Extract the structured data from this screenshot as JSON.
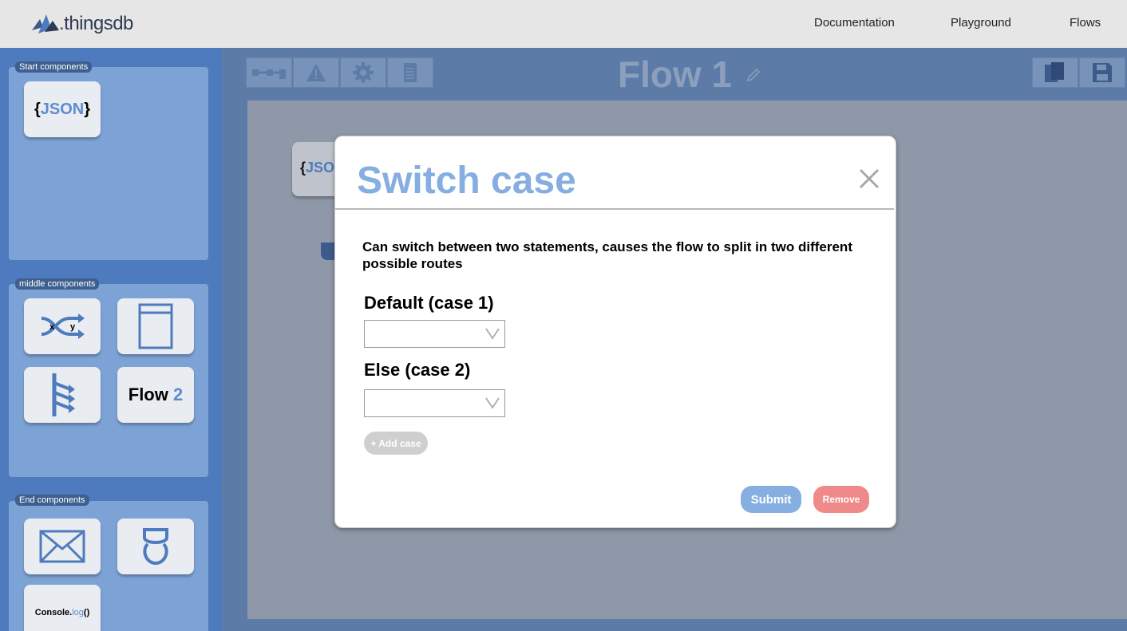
{
  "header": {
    "logo_text": ".thingsdb",
    "nav": [
      "Documentation",
      "Playground",
      "Flows"
    ]
  },
  "sidebar": {
    "start_label": "Start components",
    "middle_label": "middle components",
    "end_label": "End components",
    "start_tiles": [
      {
        "icon": "json-icon",
        "text_prefix": "{",
        "text_main": "JSON",
        "text_suffix": "}"
      }
    ],
    "middle_tiles": [
      {
        "icon": "switch-xy-icon",
        "x_label": "x",
        "y_label": "y"
      },
      {
        "icon": "panel-icon"
      },
      {
        "icon": "branch-icon"
      },
      {
        "icon": "flow2-icon",
        "text_main": "Flow",
        "text_num": "2"
      }
    ],
    "end_tiles": [
      {
        "icon": "mail-icon"
      },
      {
        "icon": "robot-icon"
      },
      {
        "icon": "console-log-icon",
        "text_main": "Console.",
        "text_blue": "log",
        "text_end": "()"
      }
    ]
  },
  "main": {
    "toolbar": [
      "connector-icon",
      "warning-icon",
      "gear-icon",
      "document-icon"
    ],
    "flow_title": "Flow 1",
    "right_toolbar": [
      "copy-icon",
      "save-icon"
    ],
    "canvas_node": {
      "prefix": "{",
      "text": "JSO"
    }
  },
  "modal": {
    "title": "Switch case",
    "description": "Can switch between two statements, causes the flow to split in two different possible routes",
    "case1_label": "Default (case 1)",
    "case1_value": "",
    "case2_label": "Else (case 2)",
    "case2_value": "",
    "add_case_label": "+ Add case",
    "submit_label": "Submit",
    "remove_label": "Remove"
  },
  "colors": {
    "accent": "#86aee0",
    "danger": "#f08a8a",
    "sidebar": "#4e7bbd"
  }
}
